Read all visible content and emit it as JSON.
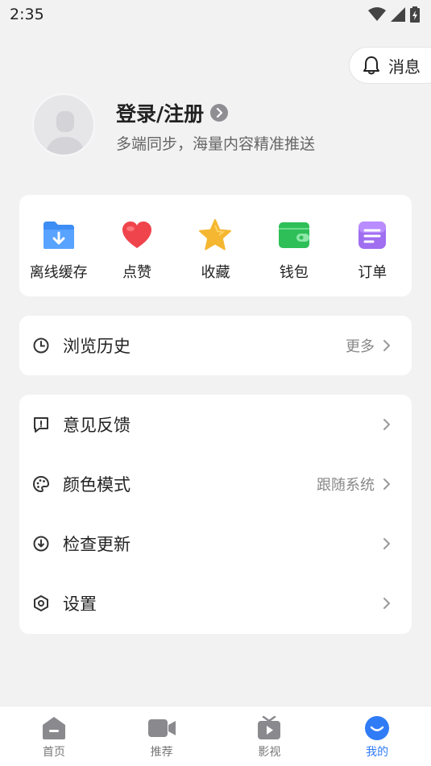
{
  "status_bar": {
    "time": "2:35"
  },
  "header": {
    "message_label": "消息"
  },
  "profile": {
    "title": "登录/注册",
    "subtitle": "多端同步，海量内容精准推送"
  },
  "quick_actions": [
    {
      "label": "离线缓存",
      "icon": "offline-cache-icon",
      "color": "#3d8df5"
    },
    {
      "label": "点赞",
      "icon": "heart-icon",
      "color": "#f0444c"
    },
    {
      "label": "收藏",
      "icon": "star-icon",
      "color": "#f5b731"
    },
    {
      "label": "钱包",
      "icon": "wallet-icon",
      "color": "#2fbf59"
    },
    {
      "label": "订单",
      "icon": "order-icon",
      "color": "#a06ef0"
    }
  ],
  "history": {
    "label": "浏览历史",
    "more_label": "更多"
  },
  "menu": {
    "feedback": {
      "label": "意见反馈"
    },
    "color_mode": {
      "label": "颜色模式",
      "value": "跟随系统"
    },
    "update": {
      "label": "检查更新"
    },
    "settings": {
      "label": "设置"
    }
  },
  "bottom_nav": [
    {
      "label": "首页",
      "icon": "home-icon",
      "active": false
    },
    {
      "label": "推荐",
      "icon": "video-camera-icon",
      "active": false
    },
    {
      "label": "影视",
      "icon": "tv-icon",
      "active": false
    },
    {
      "label": "我的",
      "icon": "smile-icon",
      "active": true
    }
  ],
  "colors": {
    "accent": "#2f7cf6",
    "background": "#f2f2f2"
  }
}
